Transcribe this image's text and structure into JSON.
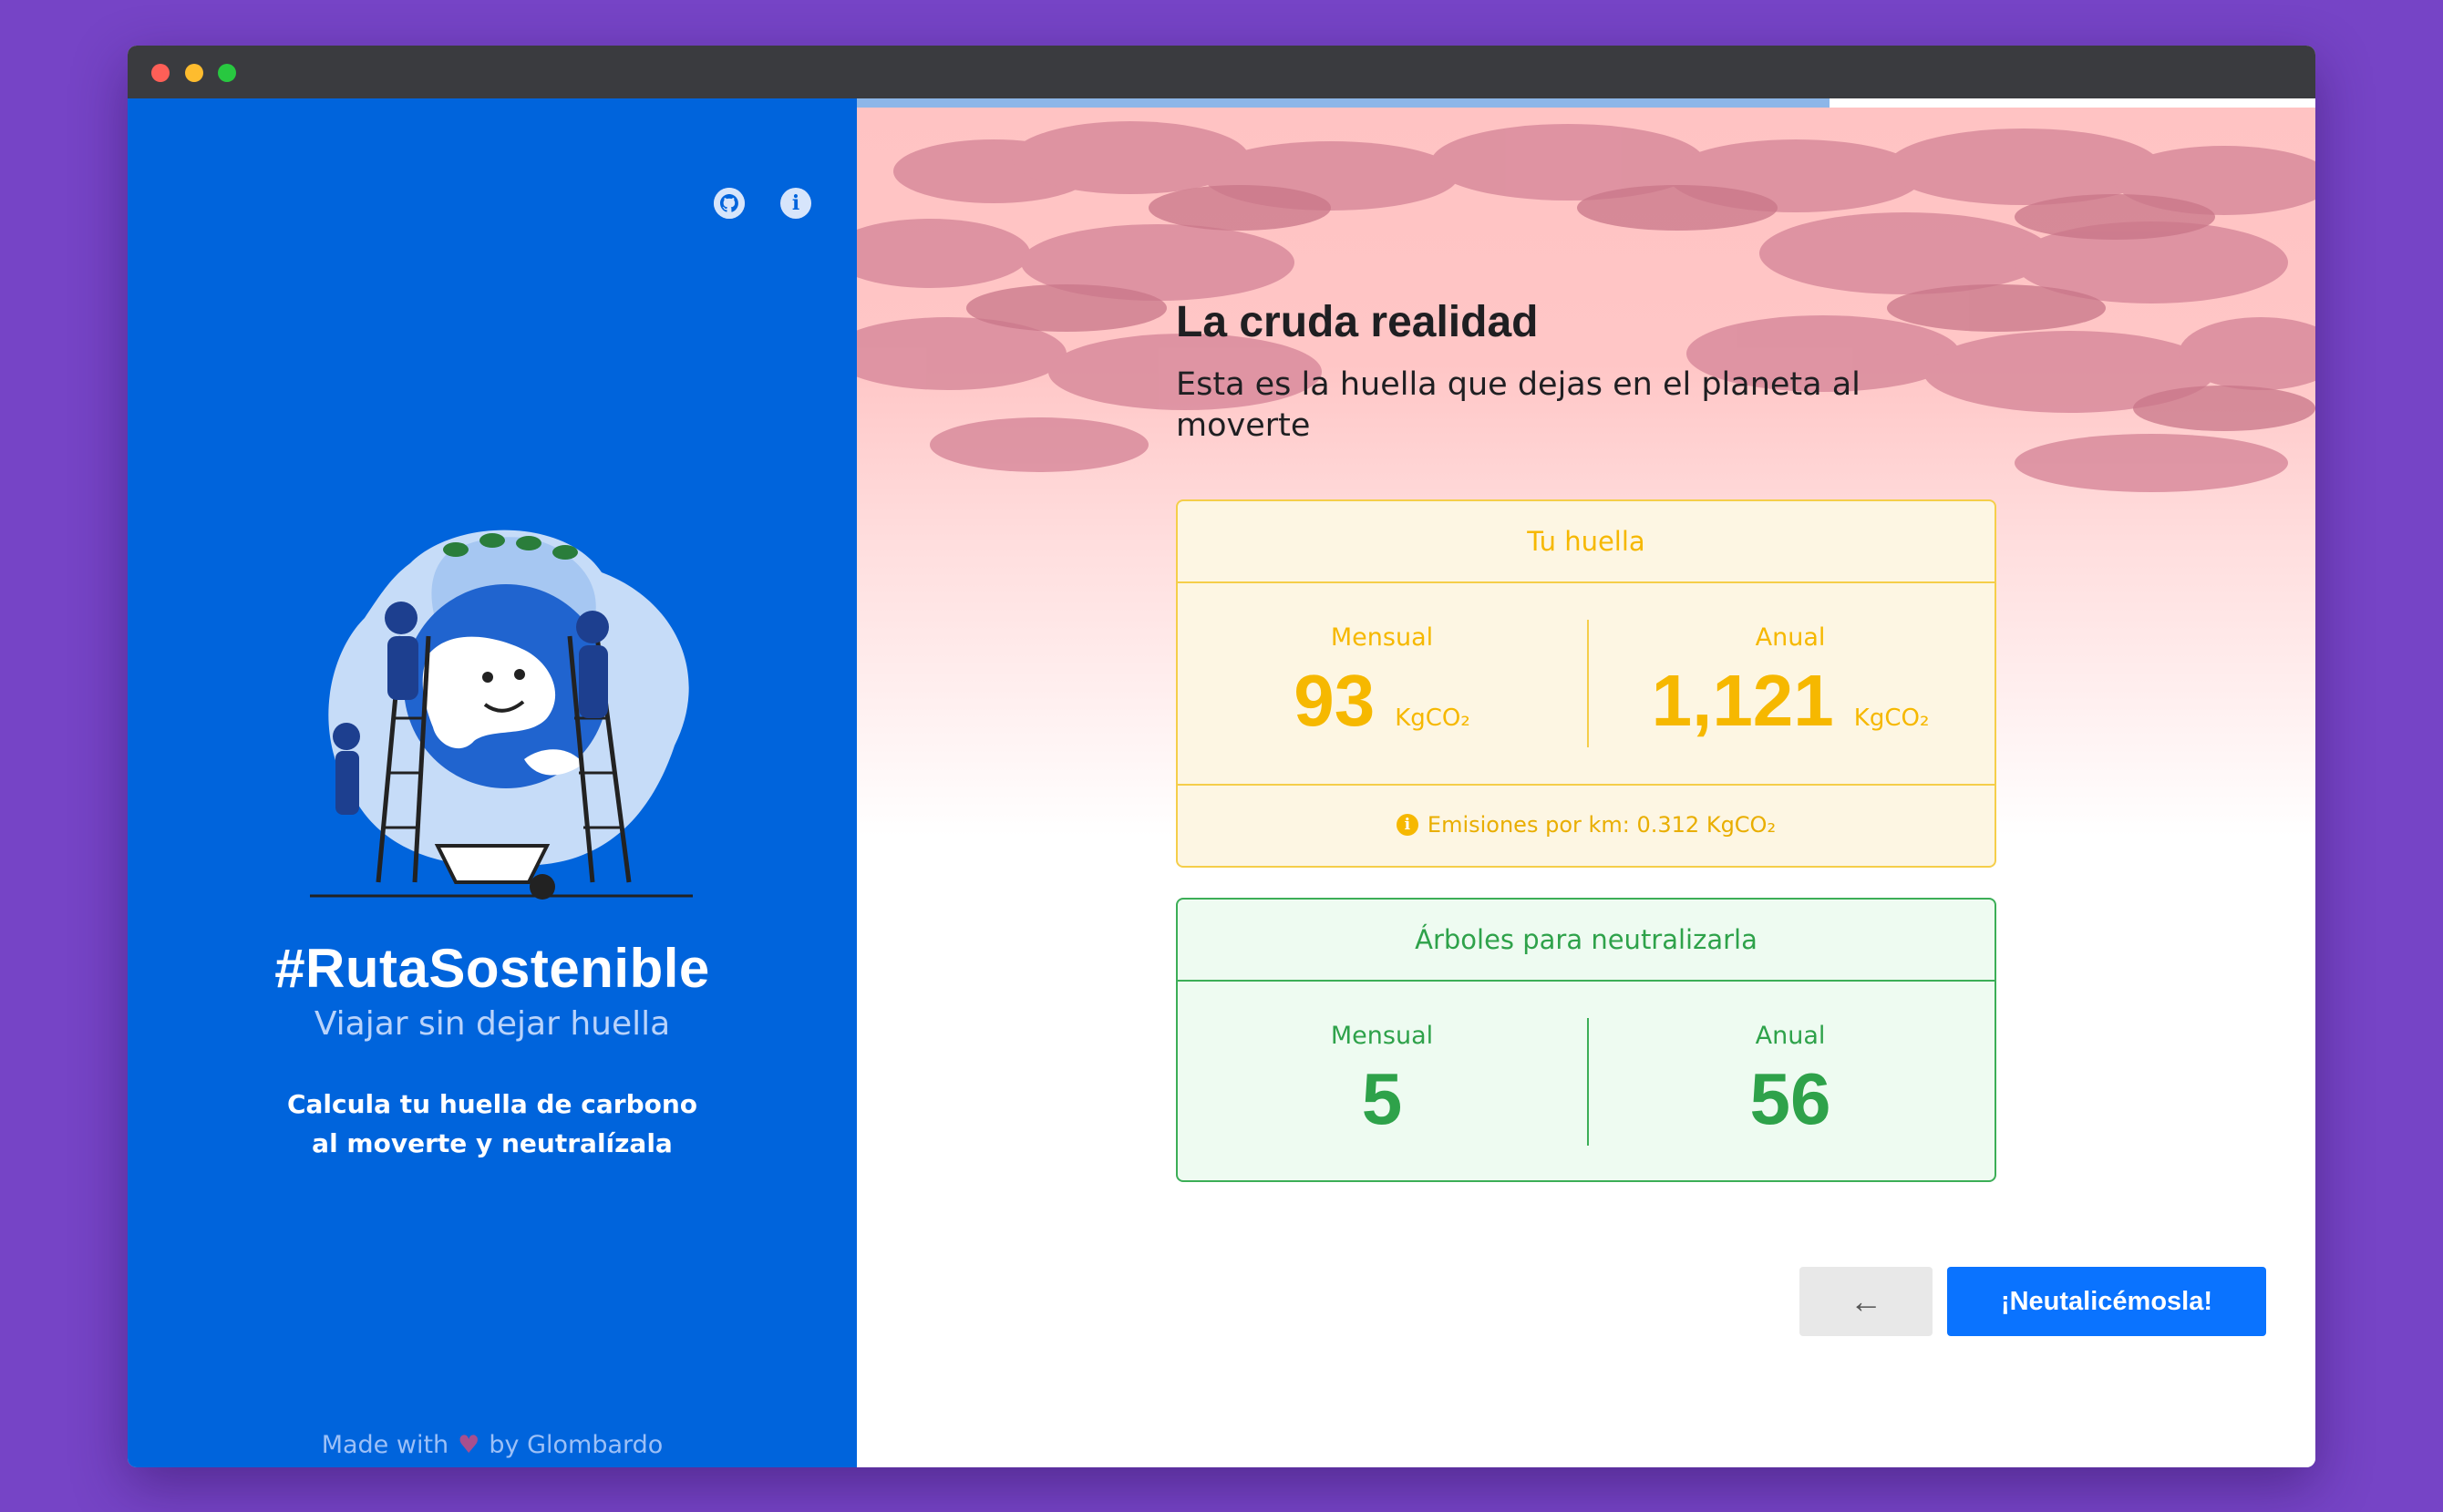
{
  "sidebar": {
    "title": "#RutaSostenible",
    "subtitle": "Viajar sin dejar huella",
    "description": "Calcula tu huella de carbono al moverte y neutralízala",
    "credits_prefix": "Made with",
    "credits_suffix": "by Glombardo",
    "icons": [
      "github-icon",
      "info-icon"
    ]
  },
  "progress": {
    "value": 0.667
  },
  "main": {
    "heading": "La cruda realidad",
    "subheading": "Esta es la huella que dejas en el planeta al moverte"
  },
  "footprint": {
    "title": "Tu huella",
    "monthly_label": "Mensual",
    "monthly_value": "93",
    "annual_label": "Anual",
    "annual_value": "1,121",
    "unit": "KgCO₂",
    "emissions_note": "Emisiones por km: 0.312 KgCO₂"
  },
  "trees": {
    "title": "Árboles para neutralizarla",
    "monthly_label": "Mensual",
    "monthly_value": "5",
    "annual_label": "Anual",
    "annual_value": "56"
  },
  "actions": {
    "back_symbol": "←",
    "primary_label": "¡Neutalicémosla!"
  },
  "colors": {
    "page_background": "#7644c6",
    "sidebar": "#0064dc",
    "footprint_accent": "#f6b800",
    "trees_accent": "#2ea24a",
    "primary_button": "#0a73ff"
  }
}
